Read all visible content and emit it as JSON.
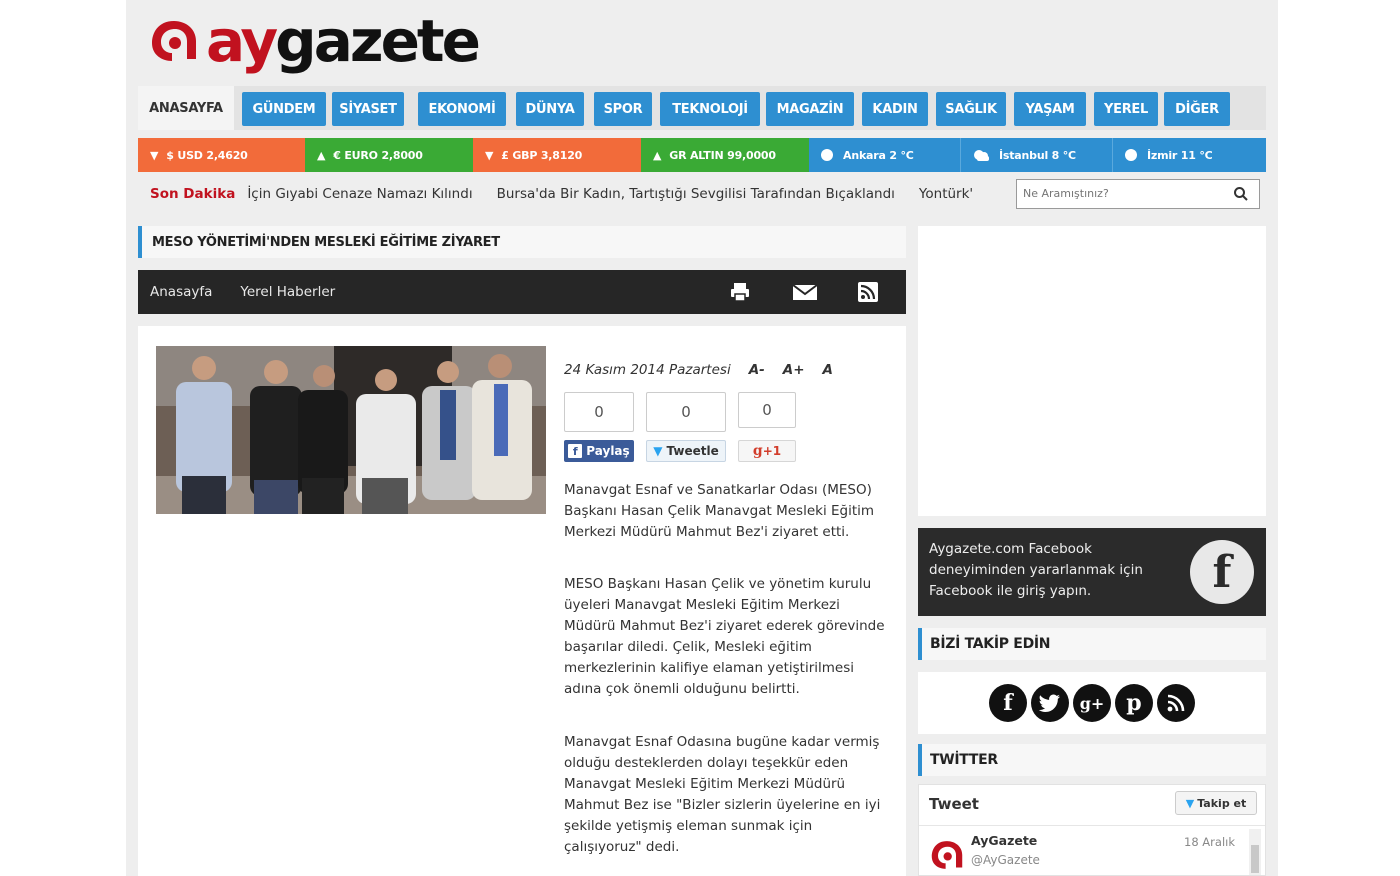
{
  "site": {
    "logo_ay": "ay",
    "logo_gazete": "gazete",
    "brand_color": "#c1121f",
    "accent": "#2e8fd1"
  },
  "nav": {
    "home": "ANASAYFA",
    "items": [
      "GÜNDEM",
      "SİYASET",
      "EKONOMİ",
      "DÜNYA",
      "SPOR",
      "TEKNOLOJİ",
      "MAGAZİN",
      "KADIN",
      "SAĞLIK",
      "YAŞAM",
      "YEREL",
      "DİĞER"
    ]
  },
  "ticker": [
    {
      "arrow": "▼",
      "text": "$ USD 2,4620",
      "color": "#f26b3a"
    },
    {
      "arrow": "▲",
      "text": "€ EURO 2,8000",
      "color": "#3aaa35"
    },
    {
      "arrow": "▼",
      "text": "£ GBP 3,8120",
      "color": "#f26b3a"
    },
    {
      "arrow": "▲",
      "text": "GR ALTIN 99,0000",
      "color": "#3aaa35"
    },
    {
      "icon": "sun-icon",
      "text": "Ankara 2 °C",
      "color": "#2e8fd1"
    },
    {
      "icon": "cloud-icon",
      "text": "İstanbul 8 °C",
      "color": "#2e8fd1"
    },
    {
      "icon": "sun-icon",
      "text": "İzmir 11 °C",
      "color": "#2e8fd1"
    }
  ],
  "breaking": {
    "label": "Son Dakika",
    "news": [
      "İçin Gıyabi Cenaze Namazı Kılındı",
      "Bursa'da Bir Kadın, Tartıştığı Sevgilisi Tarafından Bıçaklandı",
      "Yontürk'"
    ]
  },
  "search": {
    "placeholder": "Ne Aramıştınız?"
  },
  "article": {
    "title": "MESO YÖNETİMİ'NDEN MESLEKİ EĞİTİME ZİYARET",
    "breadcrumb": [
      "Anasayfa",
      "Yerel Haberler"
    ],
    "date": "24 Kasım 2014 Pazartesi",
    "font_buttons": [
      "A-",
      "A+",
      "A"
    ],
    "counts": [
      "0",
      "0",
      "0"
    ],
    "share": {
      "facebook": "Paylaş",
      "twitter": "Tweetle",
      "gplus": "+1"
    },
    "paragraphs": [
      "Manavgat Esnaf ve Sanatkarlar Odası (MESO) Başkanı Hasan Çelik Manavgat Mesleki Eğitim Merkezi Müdürü Mahmut Bez'i ziyaret etti.",
      "MESO Başkanı Hasan Çelik ve yönetim kurulu üyeleri Manavgat Mesleki Eğitim Merkezi Müdürü Mahmut Bez'i ziyaret ederek görevinde başarılar diledi. Çelik, Mesleki eğitim merkezlerinin kalifiye elaman yetiştirilmesi adına çok önemli olduğunu belirtti.",
      "Manavgat Esnaf Odasına bugüne kadar vermiş olduğu desteklerden dolayı teşekkür eden Manavgat Mesleki Eğitim Merkezi Müdürü Mahmut Bez ise \"Bizler sizlerin üyelerine en iyi şekilde yetişmiş eleman sunmak için çalışıyoruz\" dedi."
    ]
  },
  "sidebar": {
    "facebook_text": "Aygazete.com Facebook deneyiminden yararlanmak için Facebook ile giriş yapın.",
    "facebook_glyph": "f",
    "follow_title": "BİZİ TAKİP EDİN",
    "follow_icons": [
      "facebook-icon",
      "twitter-icon",
      "googleplus-icon",
      "pinterest-icon",
      "rss-icon"
    ],
    "twitter_title": "TWİTTER",
    "tweet_label": "Tweet",
    "follow_btn": "Takip et",
    "tweet_name": "AyGazete",
    "tweet_handle": "@AyGazete",
    "tweet_date": "18 Aralık"
  }
}
